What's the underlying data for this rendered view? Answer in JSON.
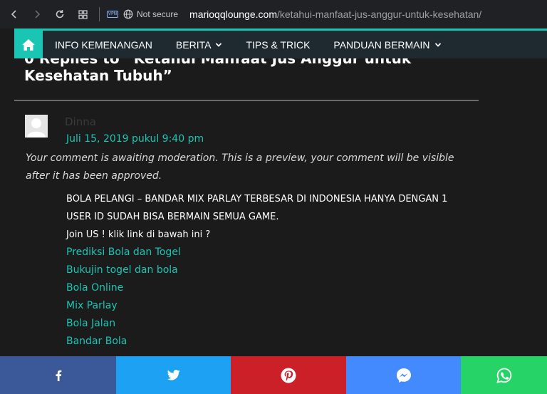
{
  "browser": {
    "vpn_label": "VPN",
    "security_text": "Not secure",
    "url_host": "marioqqlounge.com",
    "url_path": "/ketahui-manfaat-jus-anggur-untuk-kesehatan/"
  },
  "nav": {
    "items": [
      {
        "label": "INFO KEMENANGAN",
        "has_dropdown": false
      },
      {
        "label": "BERITA",
        "has_dropdown": true
      },
      {
        "label": "TIPS & TRICK",
        "has_dropdown": false
      },
      {
        "label": "PANDUAN BERMAIN",
        "has_dropdown": true
      }
    ],
    "accent_color": "#1bc5b4"
  },
  "comments": {
    "title": "0 Replies to “Ketahui Manfaat Jus Anggur untuk Kesehatan Tubuh”",
    "author": "Dinna",
    "date": "Juli 15, 2019 pukul 9:40 pm",
    "moderation_note": "Your comment is awaiting moderation. This is a preview, your comment will be visible after it has been approved.",
    "body_line1": "BOLA PELANGI – BANDAR MIX PARLAY TERBESAR DI INDONESIA HANYA DENGAN 1 USER ID SUDAH BISA BERMAIN SEMUA GAME.",
    "body_line2": "Join US ! klik link di bawah ini ?",
    "links": [
      "Prediksi Bola dan Togel",
      "Bukujin togel dan bola",
      "Bola Online",
      "Mix Parlay",
      "Bola Jalan",
      "Bandar Bola"
    ]
  },
  "share_bar": {
    "buttons": [
      {
        "network": "facebook",
        "icon": "facebook-icon",
        "color": "#3b5998"
      },
      {
        "network": "twitter",
        "icon": "twitter-icon",
        "color": "#1da1f2"
      },
      {
        "network": "pinterest",
        "icon": "pinterest-icon",
        "color": "#cb2027"
      },
      {
        "network": "messenger",
        "icon": "messenger-icon",
        "color": "#448aff"
      },
      {
        "network": "whatsapp",
        "icon": "whatsapp-icon",
        "color": "#25d366"
      }
    ]
  }
}
